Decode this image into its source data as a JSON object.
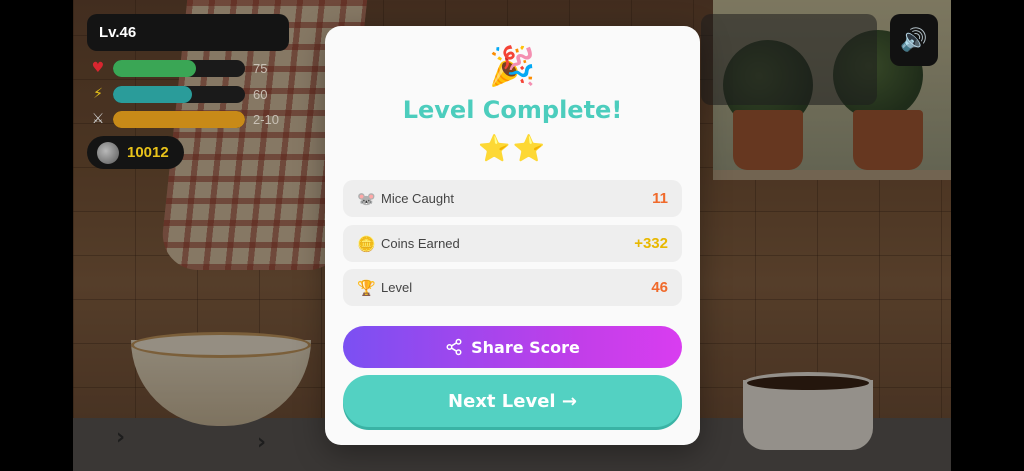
{
  "hud": {
    "level_label": "Lv.46",
    "stats": [
      {
        "icon": "heart-icon",
        "value_text": "75",
        "fill": 0.63,
        "color": "#3aa655"
      },
      {
        "icon": "lightning-icon",
        "value_text": "60",
        "fill": 0.6,
        "color": "#2a9c9a"
      },
      {
        "icon": "wand-icon",
        "value_text": "2-10",
        "fill": 1.0,
        "color": "#c88a18"
      }
    ],
    "coins": "10012",
    "sound_icon": "🔊"
  },
  "modal": {
    "party_icon": "🎉",
    "title": "Level Complete!",
    "stars": "⭐⭐",
    "star_count": 2,
    "rows": [
      {
        "icon": "🐭",
        "label": "Mice Caught",
        "value": "11",
        "color": "#f06a2b"
      },
      {
        "icon": "🪙",
        "label": "Coins Earned",
        "value": "+332",
        "color": "#e8b800"
      },
      {
        "icon": "🏆",
        "label": "Level",
        "value": "46",
        "color": "#f06a2b"
      }
    ],
    "share_label": "Share Score",
    "next_label": "Next Level →"
  }
}
